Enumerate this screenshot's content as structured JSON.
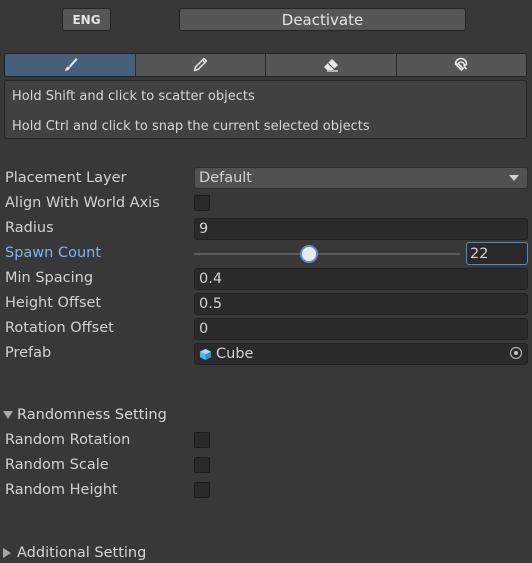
{
  "header": {
    "lang_label": "ENG",
    "deactivate_label": "Deactivate"
  },
  "toolbar": {
    "tools": [
      "brush-icon",
      "pencil-icon",
      "eraser-icon",
      "magnet-icon"
    ],
    "active_index": 0
  },
  "help": {
    "line1": "Hold Shift and click to scatter objects",
    "line2": "Hold Ctrl and click to snap the current selected objects"
  },
  "settings": {
    "placement_layer": {
      "label": "Placement Layer",
      "value": "Default"
    },
    "align_world_axis": {
      "label": "Align With World Axis",
      "checked": false
    },
    "radius": {
      "label": "Radius",
      "value": "9"
    },
    "spawn_count": {
      "label": "Spawn Count",
      "value": "22",
      "slider_fraction": 0.43
    },
    "min_spacing": {
      "label": "Min Spacing",
      "value": "0.4"
    },
    "height_offset": {
      "label": "Height Offset",
      "value": "0.5"
    },
    "rotation_offset": {
      "label": "Rotation Offset",
      "value": "0"
    },
    "prefab": {
      "label": "Prefab",
      "value": "Cube"
    }
  },
  "randomness": {
    "title": "Randomness Setting",
    "random_rotation": {
      "label": "Random Rotation",
      "checked": false
    },
    "random_scale": {
      "label": "Random Scale",
      "checked": false
    },
    "random_height": {
      "label": "Random Height",
      "checked": false
    }
  },
  "additional": {
    "title": "Additional Setting"
  },
  "colors": {
    "background": "#383838",
    "accent": "#46607c",
    "highlight_label": "#7fb2ef"
  }
}
